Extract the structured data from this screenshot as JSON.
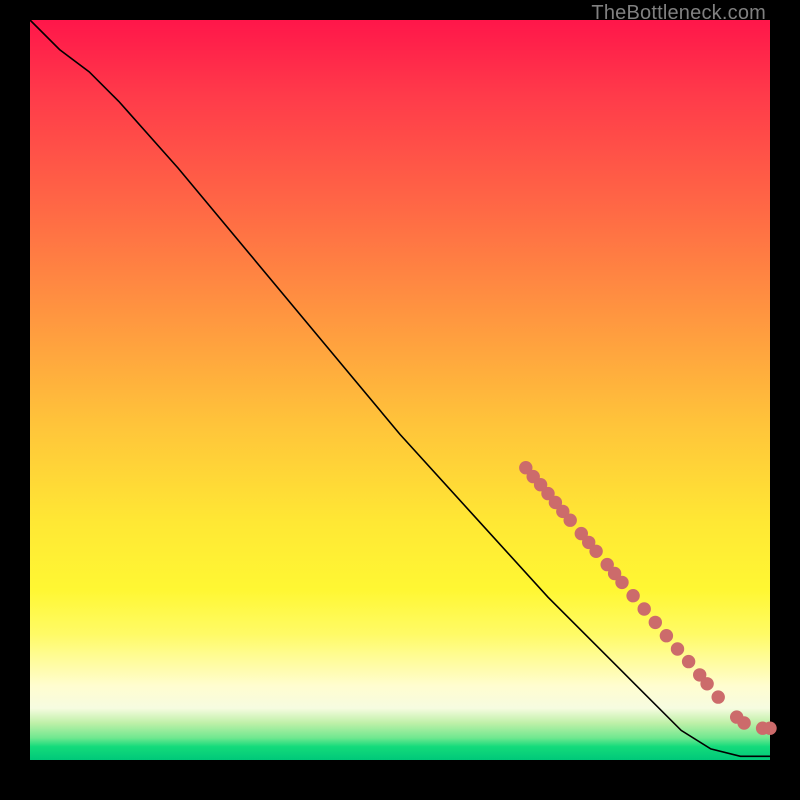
{
  "watermark": "TheBottleneck.com",
  "colors": {
    "dot": "#cc6b6b",
    "curve": "#000000"
  },
  "chart_data": {
    "type": "line",
    "title": "",
    "xlabel": "",
    "ylabel": "",
    "xlim": [
      0,
      100
    ],
    "ylim": [
      0,
      100
    ],
    "grid": false,
    "legend": false,
    "curve": [
      {
        "x": 0,
        "y": 100
      },
      {
        "x": 4,
        "y": 96
      },
      {
        "x": 8,
        "y": 93
      },
      {
        "x": 12,
        "y": 89
      },
      {
        "x": 20,
        "y": 80
      },
      {
        "x": 30,
        "y": 68
      },
      {
        "x": 40,
        "y": 56
      },
      {
        "x": 50,
        "y": 44
      },
      {
        "x": 60,
        "y": 33
      },
      {
        "x": 70,
        "y": 22
      },
      {
        "x": 80,
        "y": 12
      },
      {
        "x": 88,
        "y": 4
      },
      {
        "x": 92,
        "y": 1.5
      },
      {
        "x": 96,
        "y": 0.5
      },
      {
        "x": 100,
        "y": 0.5
      }
    ],
    "dots": [
      {
        "x": 67,
        "y": 39.5
      },
      {
        "x": 68,
        "y": 38.3
      },
      {
        "x": 69,
        "y": 37.2
      },
      {
        "x": 70,
        "y": 36.0
      },
      {
        "x": 71,
        "y": 34.8
      },
      {
        "x": 72,
        "y": 33.6
      },
      {
        "x": 73,
        "y": 32.4
      },
      {
        "x": 74.5,
        "y": 30.6
      },
      {
        "x": 75.5,
        "y": 29.4
      },
      {
        "x": 76.5,
        "y": 28.2
      },
      {
        "x": 78,
        "y": 26.4
      },
      {
        "x": 79,
        "y": 25.2
      },
      {
        "x": 80,
        "y": 24.0
      },
      {
        "x": 81.5,
        "y": 22.2
      },
      {
        "x": 83,
        "y": 20.4
      },
      {
        "x": 84.5,
        "y": 18.6
      },
      {
        "x": 86,
        "y": 16.8
      },
      {
        "x": 87.5,
        "y": 15.0
      },
      {
        "x": 89,
        "y": 13.3
      },
      {
        "x": 90.5,
        "y": 11.5
      },
      {
        "x": 91.5,
        "y": 10.3
      },
      {
        "x": 93,
        "y": 8.5
      },
      {
        "x": 95.5,
        "y": 5.8
      },
      {
        "x": 96.5,
        "y": 5.0
      },
      {
        "x": 99,
        "y": 4.3
      },
      {
        "x": 100,
        "y": 4.3
      }
    ],
    "dot_radius_percent": 0.9
  }
}
